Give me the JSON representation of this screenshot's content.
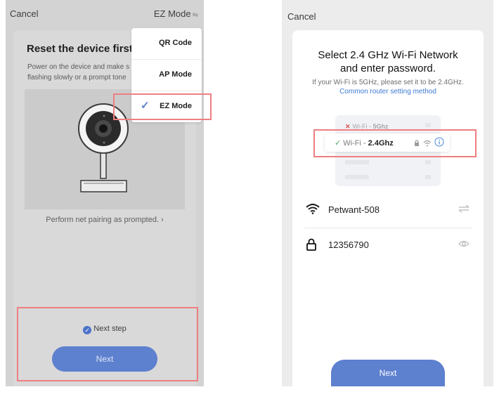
{
  "left_screen": {
    "cancel_label": "Cancel",
    "mode_label": "EZ Mode",
    "title": "Reset the device first",
    "desc_line1": "Power on the device and make s",
    "desc_line2": "flashing slowly or a prompt tone",
    "hint": "Perform net pairing as prompted. ›",
    "next_step_label": "Next step",
    "next_button_label": "Next",
    "menu": {
      "items": [
        {
          "label": "QR Code"
        },
        {
          "label": "AP Mode"
        },
        {
          "label": "EZ Mode",
          "selected": true
        }
      ]
    }
  },
  "right_screen": {
    "cancel_label": "Cancel",
    "title_line1": "Select 2.4 GHz Wi-Fi Network",
    "title_line2": "and enter password.",
    "subtitle": "If your Wi-Fi is 5GHz, please set it to be 2.4GHz.",
    "link": "Common router setting method",
    "illustration": {
      "wifi_5g_prefix": "Wi-Fi - ",
      "wifi_5g_band": "5Ghz",
      "wifi_24_prefix": "Wi-Fi - ",
      "wifi_24_band": "2.4Ghz"
    },
    "network_name": "Petwant-508",
    "password": "12356790",
    "next_button_label": "Next"
  },
  "colors": {
    "accent_blue": "#5d80cf",
    "link_blue": "#3f7ad4",
    "highlight_red": "#ee7f80",
    "check_green": "#4aa36a",
    "error_red": "#d85050"
  },
  "icons": [
    "swap-icon",
    "checkmark-icon",
    "wifi-icon",
    "lock-icon",
    "info-icon",
    "eye-icon",
    "camera-icon"
  ]
}
